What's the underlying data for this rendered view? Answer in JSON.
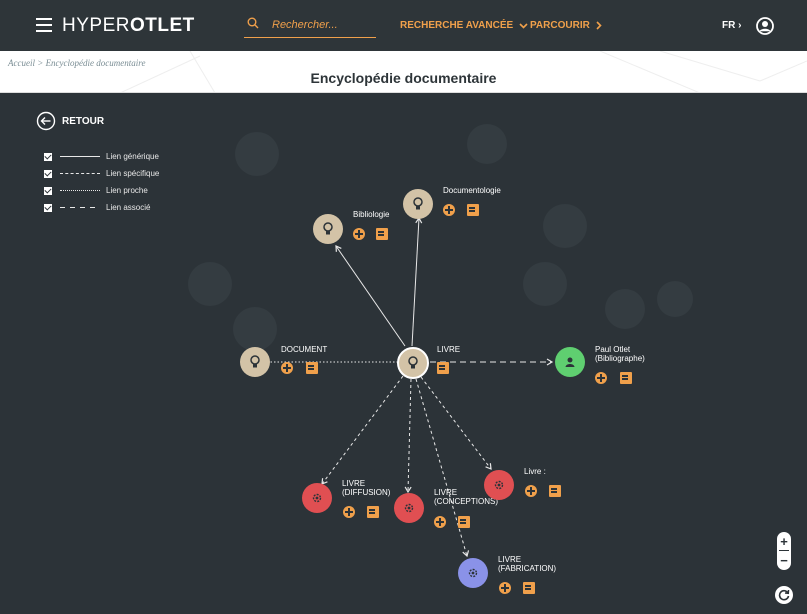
{
  "header": {
    "brand_light": "HYPER",
    "brand_bold": "OTLET",
    "search_placeholder": "Rechercher...",
    "advanced_search": "RECHERCHE AVANCÉE",
    "browse": "PARCOURIR",
    "lang": "FR"
  },
  "breadcrumb": {
    "home": "Accueil",
    "sep": " > ",
    "current": "Encyclopédie documentaire"
  },
  "page_title": "Encyclopédie documentaire",
  "back_label": "RETOUR",
  "legend": [
    {
      "label": "Lien générique"
    },
    {
      "label": "Lien spécifique"
    },
    {
      "label": "Lien proche"
    },
    {
      "label": "Lien associé"
    }
  ],
  "nodes": {
    "livre": "LIVRE",
    "bibliologie": "Bibliologie",
    "documentologie": "Documentologie",
    "document": "DOCUMENT",
    "paul_otlet_1": "Paul Otlet",
    "paul_otlet_2": "(Bibliographe)",
    "diffusion_1": "LIVRE",
    "diffusion_2": "(DIFFUSION)",
    "conceptions_1": "LIVRE",
    "conceptions_2": "(CONCEPTIONS)",
    "livre_colon": "Livre :",
    "fabrication_1": "LIVRE",
    "fabrication_2": "(FABRICATION)"
  },
  "colors": {
    "accent": "#f0a04b",
    "background": "#2c3338",
    "concept": "#d3c3a7",
    "person": "#5fcf70",
    "red": "#e04f52",
    "blue": "#8a92e8"
  }
}
